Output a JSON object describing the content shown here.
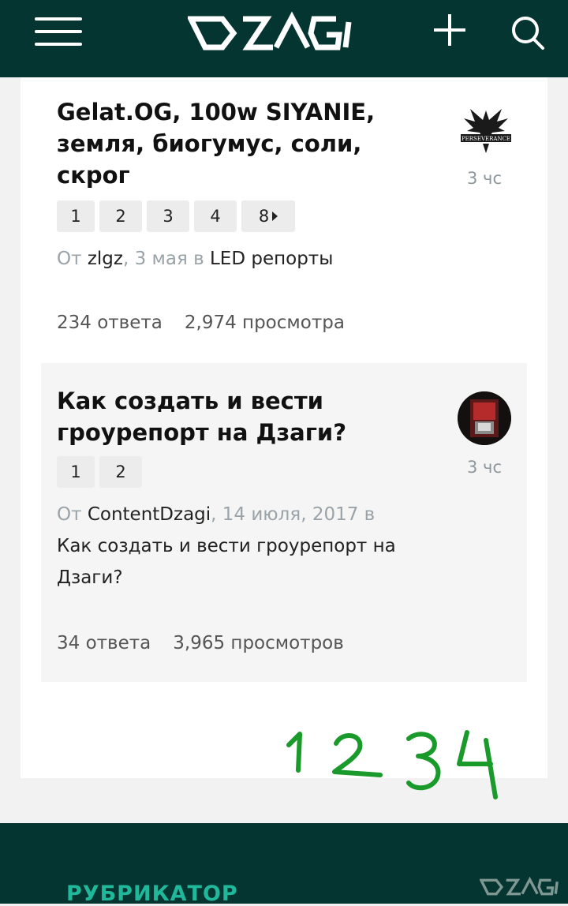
{
  "header": {
    "logo_text": "DZAGI",
    "menu_icon": "hamburger-icon",
    "add_icon": "plus-icon",
    "search_icon": "search-icon"
  },
  "topics": [
    {
      "title": "Gelat.OG, 100w SIYANIE, земля, биогумус, соли, скрог",
      "pages": [
        "1",
        "2",
        "3",
        "4",
        "8"
      ],
      "meta_prefix": "От ",
      "author": "zlgz",
      "date_text": ", 3 мая в ",
      "category": "LED репорты",
      "replies": "234 ответа",
      "views": "2,974 просмотра",
      "time": "3 чс",
      "avatar_text": "PERSEVERANCE"
    },
    {
      "title": "Как создать и вести гроурепорт на Дзаги?",
      "pages": [
        "1",
        "2"
      ],
      "meta_prefix": "От ",
      "author": "ContentDzagi",
      "date_text": ", 14 июля, 2017 в",
      "category": "Как создать и вести гроурепорт на Дзаги?",
      "replies": "34 ответа",
      "views": "3,965 просмотров",
      "time": "3 чс"
    }
  ],
  "handwriting": "1234",
  "footer": {
    "label": "РУБРИКАТОР",
    "logo_text": "DZAGI"
  },
  "colors": {
    "header_bg": "#053530",
    "accent": "#1fb89a",
    "handwriting": "#1a9a2a"
  }
}
